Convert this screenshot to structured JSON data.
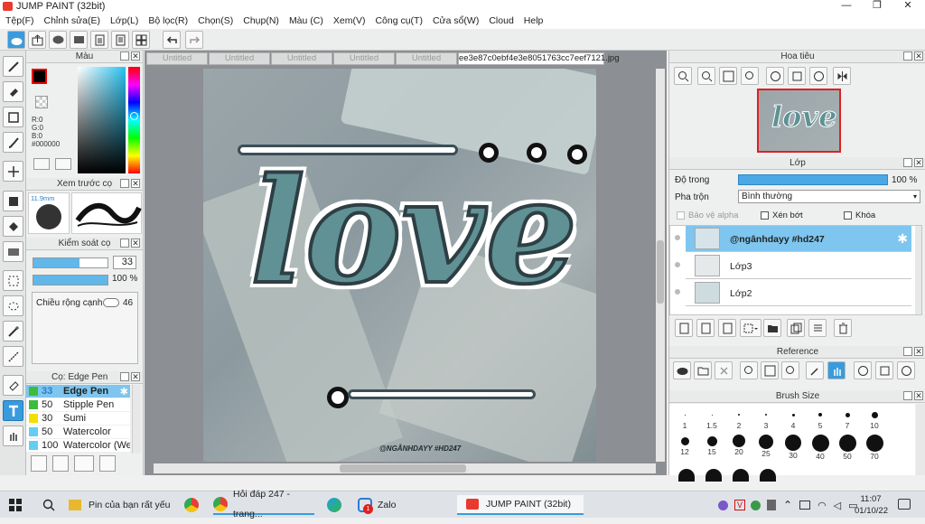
{
  "app": {
    "title": "JUMP PAINT (32bit)"
  },
  "menu": [
    "Tệp(F)",
    "Chỉnh sửa(E)",
    "Lớp(L)",
    "Bộ lọc(R)",
    "Chọn(S)",
    "Chụp(N)",
    "Màu (C)",
    "Xem(V)",
    "Công cụ(T)",
    "Cửa sổ(W)",
    "Cloud",
    "Help"
  ],
  "color_panel": {
    "title": "Màu",
    "r": "R:0",
    "g": "G:0",
    "b": "B:0",
    "hex": "#000000"
  },
  "preview_panel": {
    "title": "Xem trước cọ",
    "size": "11.9mm"
  },
  "brush_control": {
    "title": "Kiểm soát cọ",
    "size_value": "33",
    "opacity_value": "100 %",
    "edge_label": "Chiều rộng cạnh",
    "edge_value": "46"
  },
  "brush_list": {
    "title": "Cọ: Edge Pen",
    "items": [
      {
        "size": "33",
        "name": "Edge Pen"
      },
      {
        "size": "50",
        "name": "Stipple Pen"
      },
      {
        "size": "30",
        "name": "Sumi"
      },
      {
        "size": "50",
        "name": "Watercolor"
      },
      {
        "size": "100",
        "name": "Watercolor (Wet"
      }
    ]
  },
  "tabs": [
    "Untitled",
    "Untitled",
    "Untitled",
    "Untitled",
    "Untitled",
    "ee3e87c0ebf4e3e8051763cc7eef7121.jpg"
  ],
  "canvas": {
    "art_text": "love",
    "watermark": "@NGÂNHDAYY #HD247"
  },
  "navigator": {
    "title": "Hoa tiêu"
  },
  "layers": {
    "title": "Lớp",
    "opacity_label": "Độ trong",
    "opacity_value": "100 %",
    "blend_label": "Pha trộn",
    "blend_value": "Bình thường",
    "protect_alpha": "Bảo vệ alpha",
    "clip": "Xén bớt",
    "lock": "Khóa",
    "items": [
      "@ngânhdayy #hd247",
      "Lớp3",
      "Lớp2"
    ]
  },
  "reference": {
    "title": "Reference"
  },
  "brush_size": {
    "title": "Brush Size",
    "row1": [
      "1",
      "1.5",
      "2",
      "3",
      "4",
      "5",
      "7",
      "10"
    ],
    "row2": [
      "12",
      "15",
      "20",
      "25",
      "30",
      "40",
      "50",
      "70"
    ]
  },
  "taskbar": {
    "pinned": "Pin của bạn rất yếu",
    "chrome_tab": "Hỏi đáp 247 - trang...",
    "zalo": "Zalo",
    "zalo_badge": "1",
    "jump": "JUMP PAINT (32bit)",
    "time": "11:07",
    "date": "01/10/22"
  }
}
